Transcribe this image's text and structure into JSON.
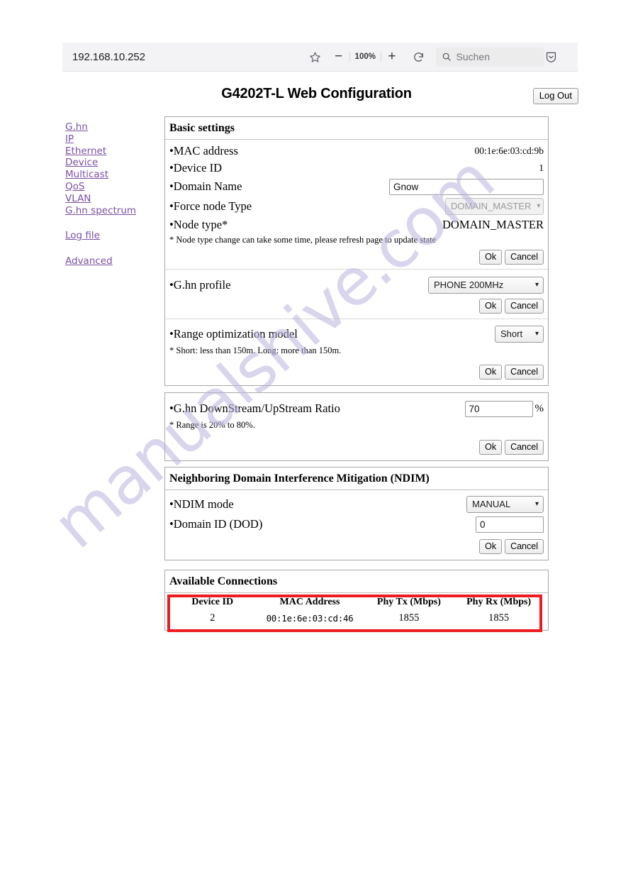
{
  "browser": {
    "url": "192.168.10.252",
    "bookmark_icon": "star-icon",
    "zoom_out_label": "−",
    "zoom_level": "100%",
    "zoom_in_label": "+",
    "reload_icon": "reload-icon",
    "search_icon": "search-icon",
    "search_placeholder": "Suchen",
    "shield_icon": "shield-icon"
  },
  "page": {
    "title": "G4202T-L Web Configuration",
    "logout_label": "Log Out"
  },
  "sidebar": {
    "items": [
      {
        "label": "G.hn"
      },
      {
        "label": "IP"
      },
      {
        "label": "Ethernet"
      },
      {
        "label": "Device"
      },
      {
        "label": "Multicast"
      },
      {
        "label": "QoS"
      },
      {
        "label": "VLAN"
      },
      {
        "label": "G.hn spectrum"
      }
    ],
    "log_file": "Log file",
    "advanced": "Advanced"
  },
  "basic_settings": {
    "title": "Basic settings",
    "mac_address_label": "•MAC address",
    "mac_address_value": "00:1e:6e:03:cd:9b",
    "device_id_label": "•Device ID",
    "device_id_value": "1",
    "domain_name_label": "•Domain Name",
    "domain_name_value": "Gnow",
    "force_node_type_label": "•Force node Type",
    "force_node_type_value": "DOMAIN_MASTER",
    "node_type_label": "•Node type*",
    "node_type_value": "DOMAIN_MASTER",
    "node_type_note": "* Node type change can take some time, please refresh page to update state",
    "ok_label": "Ok",
    "cancel_label": "Cancel",
    "ghn_profile_label": "•G.hn profile",
    "ghn_profile_value": "PHONE 200MHz",
    "range_label": "•Range optimization model",
    "range_value": "Short",
    "range_note": "* Short: less than 150m. Long: more than 150m."
  },
  "ratio_panel": {
    "label": "•G.hn DownStream/UpStream Ratio",
    "value": "70",
    "unit": "%",
    "note": "* Range is 20% to 80%.",
    "ok_label": "Ok",
    "cancel_label": "Cancel"
  },
  "ndim_panel": {
    "title": "Neighboring Domain Interference Mitigation (NDIM)",
    "mode_label": "•NDIM mode",
    "mode_value": "MANUAL",
    "dod_label": "•Domain ID (DOD)",
    "dod_value": "0",
    "ok_label": "Ok",
    "cancel_label": "Cancel"
  },
  "connections_panel": {
    "title": "Available Connections",
    "columns": [
      "Device ID",
      "MAC Address",
      "Phy Tx (Mbps)",
      "Phy Rx (Mbps)"
    ],
    "rows": [
      {
        "device_id": "2",
        "mac": "00:1e:6e:03:cd:46",
        "phy_tx": "1855",
        "phy_rx": "1855"
      }
    ]
  },
  "annotation": {
    "highlight_color": "#ee1c20"
  },
  "watermark": {
    "text": "manualshive.com"
  }
}
